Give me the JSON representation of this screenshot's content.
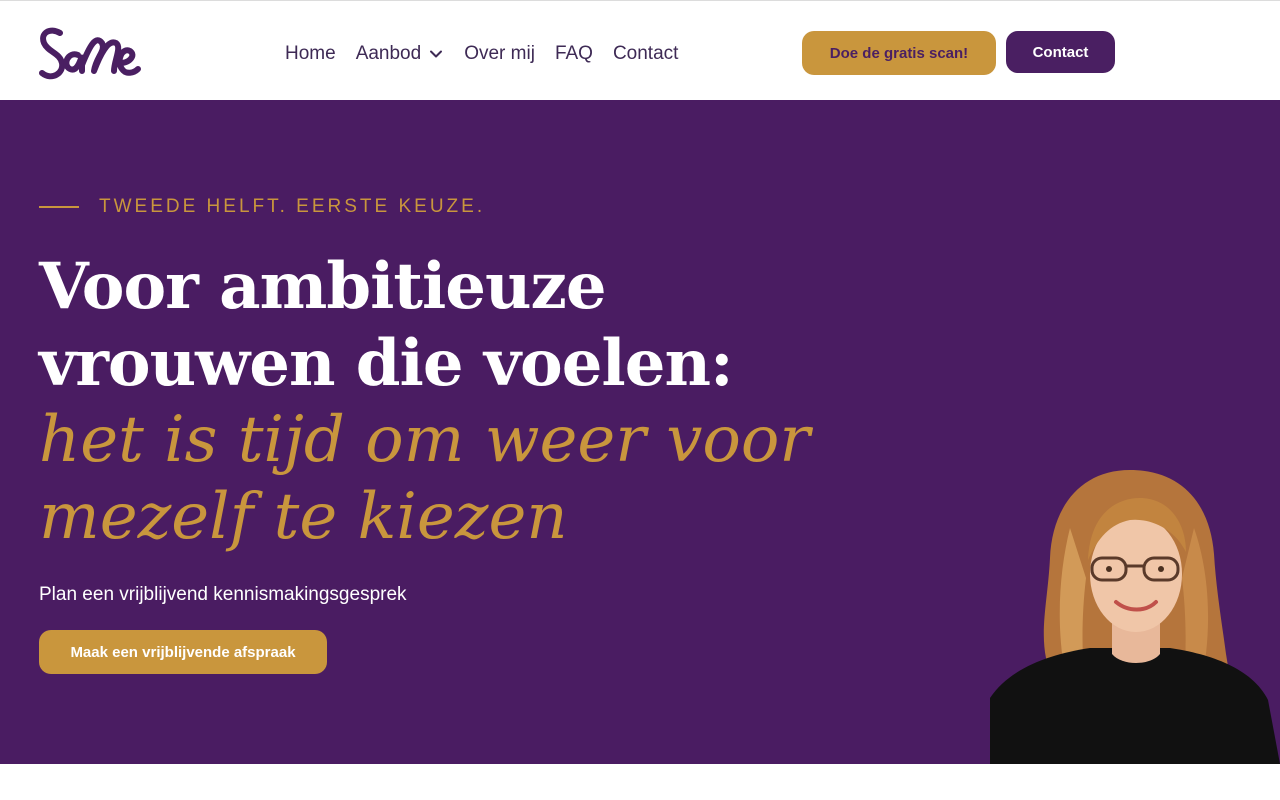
{
  "brand": {
    "logo_text": "SaMe",
    "logo_color": "#4a1f62"
  },
  "nav": {
    "items": [
      {
        "label": "Home"
      },
      {
        "label": "Aanbod",
        "has_dropdown": true
      },
      {
        "label": "Over mij"
      },
      {
        "label": "FAQ"
      },
      {
        "label": "Contact"
      }
    ]
  },
  "header": {
    "cta_scan_label": "Doe de gratis scan!",
    "cta_contact_label": "Contact"
  },
  "hero": {
    "eyebrow": "TWEEDE HELFT. EERSTE KEUZE.",
    "headline_line1": "Voor ambitieuze",
    "headline_line2": "vrouwen die voelen:",
    "headline_accent_line1": "het is tijd om weer voor",
    "headline_accent_line2": "mezelf te kiezen",
    "subtitle": "Plan een vrijblijvend kennismakingsgesprek",
    "cta_label": "Maak een vrijblijvende afspraak"
  },
  "colors": {
    "purple": "#4a1c62",
    "gold": "#c9963d",
    "white": "#ffffff",
    "nav_text": "#3e2a55"
  },
  "icons": {
    "dropdown": "chevron-down-icon",
    "portrait": "woman-portrait-photo"
  }
}
